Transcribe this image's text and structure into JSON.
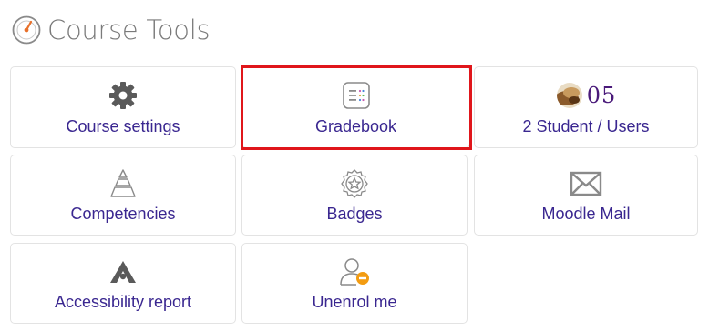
{
  "header": {
    "title": "Course Tools",
    "icon": "dashboard-gauge-icon"
  },
  "tiles": {
    "course_settings": {
      "label": "Course settings",
      "icon": "gear-icon"
    },
    "gradebook": {
      "label": "Gradebook",
      "icon": "gradebook-icon",
      "selected": true
    },
    "students": {
      "label": "2 Student / Users",
      "count": "05",
      "icon": "user-avatar"
    },
    "competencies": {
      "label": "Competencies",
      "icon": "pyramid-icon"
    },
    "badges": {
      "label": "Badges",
      "icon": "badge-icon"
    },
    "moodle_mail": {
      "label": "Moodle Mail",
      "icon": "envelope-icon"
    },
    "accessibility": {
      "label": "Accessibility report",
      "icon": "accessibility-icon"
    },
    "unenrol": {
      "label": "Unenrol me",
      "icon": "user-remove-icon"
    }
  },
  "colors": {
    "accent": "#3a2790",
    "highlight": "#e0161b",
    "border": "#e3e3e3"
  }
}
